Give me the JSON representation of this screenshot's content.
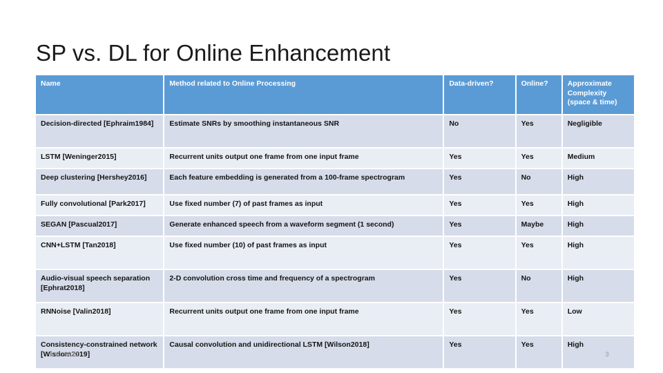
{
  "slide": {
    "title": "SP vs. DL for Online Enhancement",
    "footer_date": "1/11/2022",
    "page_number": "3",
    "header_color": "#5B9BD5",
    "band_color_a": "#D6DCE9",
    "band_color_b": "#E9EDF4"
  },
  "table": {
    "headers": [
      "Name",
      "Method related to Online Processing",
      "Data-driven?",
      "Online?",
      "Approximate Complexity (space & time)"
    ],
    "rows": [
      {
        "name": "Decision-directed [Ephraim1984]",
        "method": "Estimate SNRs by smoothing instantaneous SNR",
        "data_driven": "No",
        "online": "Yes",
        "complexity": "Negligible"
      },
      {
        "name": "LSTM [Weninger2015]",
        "method": "Recurrent units output one frame from one input frame",
        "data_driven": "Yes",
        "online": "Yes",
        "complexity": "Medium"
      },
      {
        "name": "Deep clustering [Hershey2016]",
        "method": "Each feature embedding is generated from a 100-frame spectrogram",
        "data_driven": "Yes",
        "online": "No",
        "complexity": "High"
      },
      {
        "name": "Fully convolutional [Park2017]",
        "method": "Use fixed number (7) of past frames as input",
        "data_driven": "Yes",
        "online": "Yes",
        "complexity": "High"
      },
      {
        "name": "SEGAN [Pascual2017]",
        "method": "Generate enhanced speech from a waveform segment (1 second)",
        "data_driven": "Yes",
        "online": "Maybe",
        "complexity": "High"
      },
      {
        "name": "CNN+LSTM [Tan2018]",
        "method": "Use fixed number (10) of past frames as input",
        "data_driven": "Yes",
        "online": "Yes",
        "complexity": "High"
      },
      {
        "name": "Audio-visual speech separation [Ephrat2018]",
        "method": "2-D convolution cross time and frequency of a spectrogram",
        "data_driven": "Yes",
        "online": "No",
        "complexity": "High"
      },
      {
        "name": "RNNoise [Valin2018]",
        "method": "Recurrent units output one frame from one input frame",
        "data_driven": "Yes",
        "online": "Yes",
        "complexity": "Low"
      },
      {
        "name": "Consistency-constrained network [Wisdom2019]",
        "method": "Causal convolution and unidirectional LSTM [Wilson2018]",
        "data_driven": "Yes",
        "online": "Yes",
        "complexity": "High"
      }
    ]
  }
}
